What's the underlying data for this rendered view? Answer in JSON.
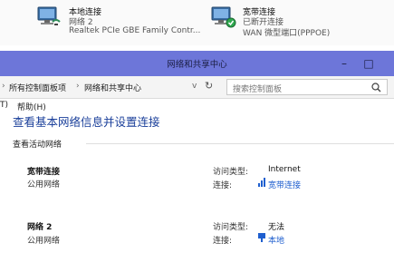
{
  "connections": [
    {
      "name": "本地连接",
      "status": "网络 2",
      "adapter": "Realtek PCIe GBE Family Contr..."
    },
    {
      "name": "宽带连接",
      "status": "已断开连接",
      "adapter": "WAN 微型端口(PPPOE)"
    }
  ],
  "window": {
    "title": "网络和共享中心"
  },
  "address": {
    "crumbs": [
      "所有控制面板项",
      "网络和共享中心"
    ],
    "search_placeholder": "搜索控制面板"
  },
  "menu": {
    "left_fragment": "T)",
    "help": "帮助(H)"
  },
  "main": {
    "heading": "查看基本网络信息并设置连接",
    "section_title": "查看活动网络",
    "networks": [
      {
        "name": "宽带连接",
        "type": "公用网络",
        "access_label": "访问类型:",
        "access_value": "Internet",
        "conn_label": "连接:",
        "conn_value": "宽带连接"
      },
      {
        "name": "网络  2",
        "type": "公用网络",
        "access_label": "访问类型:",
        "access_value": "无法",
        "conn_label": "连接:",
        "conn_value": "本地"
      }
    ]
  },
  "colors": {
    "titlebar": "#6d76d9",
    "link": "#1f5fcf",
    "heading": "#1a3f9a"
  }
}
